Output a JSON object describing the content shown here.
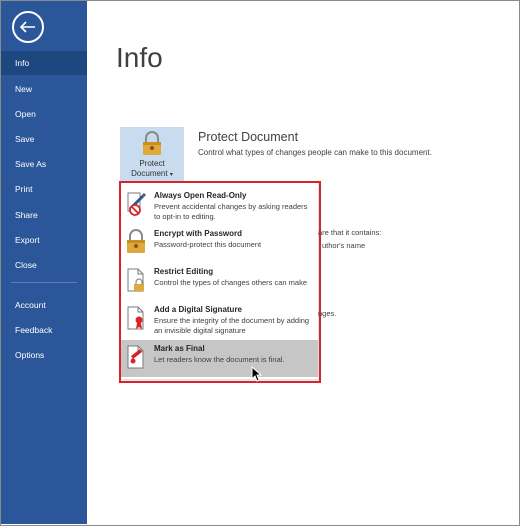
{
  "sidebar": {
    "items": [
      {
        "label": "Info",
        "active": true
      },
      {
        "label": "New"
      },
      {
        "label": "Open"
      },
      {
        "label": "Save"
      },
      {
        "label": "Save As"
      },
      {
        "label": "Print"
      },
      {
        "label": "Share"
      },
      {
        "label": "Export"
      },
      {
        "label": "Close"
      },
      {
        "label": "Account"
      },
      {
        "label": "Feedback"
      },
      {
        "label": "Options"
      }
    ],
    "back_icon": "back-arrow-icon",
    "color": "#2b579a"
  },
  "main": {
    "title": "Info",
    "protect": {
      "button_line1": "Protect",
      "button_line2": "Document",
      "heading": "Protect Document",
      "description": "Control what types of changes people can make to this document."
    },
    "partial_texts": {
      "t1": "are that it contains:",
      "t2": "uthor's name",
      "t3": "nges."
    }
  },
  "dropdown": {
    "items": [
      {
        "title": "Always Open Read-Only",
        "desc": "Prevent accidental changes by asking readers to opt-in to editing.",
        "icon": "read-only-icon"
      },
      {
        "title": "Encrypt with Password",
        "desc": "Password-protect this document",
        "icon": "lock-key-icon"
      },
      {
        "title": "Restrict Editing",
        "desc": "Control the types of changes others can make",
        "icon": "restrict-editing-icon"
      },
      {
        "title": "Add a Digital Signature",
        "desc": "Ensure the integrity of the document by adding an invisible digital signature",
        "icon": "digital-signature-icon"
      },
      {
        "title": "Mark as Final",
        "desc": "Let readers know the document is final.",
        "icon": "mark-final-icon",
        "hovered": true
      }
    ],
    "highlight_color": "#d8232a"
  }
}
